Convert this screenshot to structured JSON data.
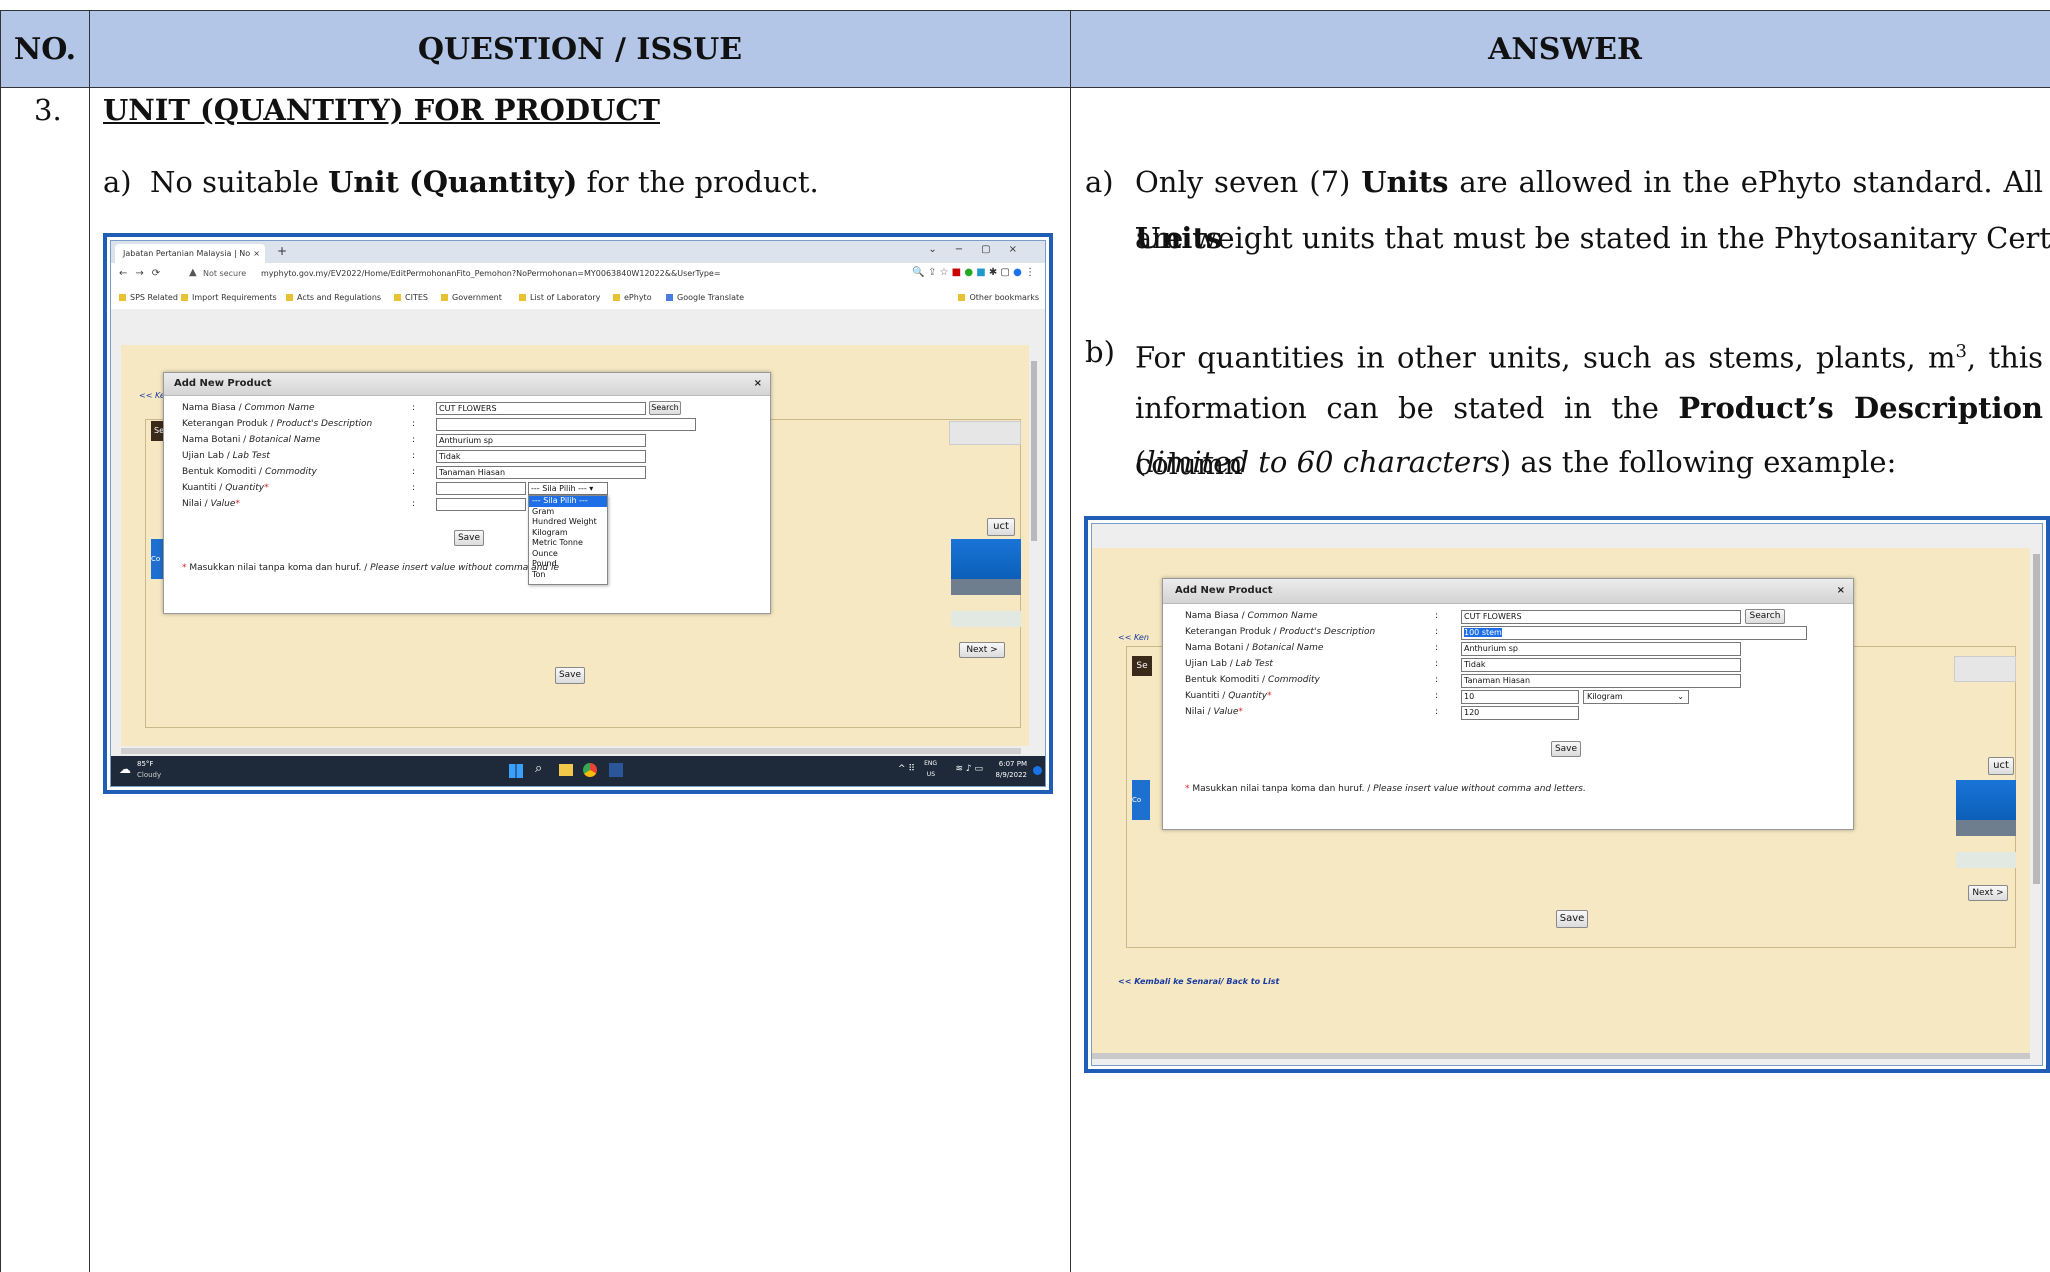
{
  "header": {
    "no": "NO.",
    "question": "QUESTION / ISSUE",
    "answer": "ANSWER"
  },
  "row": {
    "number": "3.",
    "title": "UNIT (QUANTITY) FOR PRODUCT"
  },
  "question": {
    "prefix": "a)",
    "text_before": "No suitable ",
    "bold": "Unit (Quantity)",
    "text_after": " for the product."
  },
  "answer": {
    "a_prefix": "a)",
    "a_line1_pre": "Only seven (7) ",
    "a_line1_bold1": "Units",
    "a_line1_mid": " are allowed in the ePhyto standard. All ",
    "a_line1_bold2": "Units",
    "a_line2": "are weight units that must be stated in the Phytosanitary Certificate.",
    "b_prefix": "b)",
    "b_line1_pre": "For quantities in other units, such as stems, plants, m",
    "b_line1_sup": "3",
    "b_line1_post": ", this",
    "b_line2_pre": "information can be stated in the ",
    "b_line2_bold": "Product’s Description",
    "b_line2_post": " column",
    "b_line3_open": "(",
    "b_line3_italic": "limited to 60 characters",
    "b_line3_post": ") as the following example:"
  },
  "shot1": {
    "tab_title": "Jabatan Pertanian Malaysia | No",
    "not_secure": "Not secure",
    "url": "myphyto.gov.my/EV2022/Home/EditPermohonanFito_Pemohon?NoPermohonan=MY0063840W12022&&UserType=",
    "bookmarks": [
      "SPS Related",
      "Import Requirements",
      "Acts and Regulations",
      "CITES",
      "Government",
      "List of Laboratory",
      "ePhyto",
      "Google Translate"
    ],
    "other_bookmarks": "Other bookmarks",
    "back_link": "<< Ken",
    "dialog_title": "Add New Product",
    "close": "×",
    "fields": [
      {
        "label": "Nama Biasa / ",
        "label_it": "Common Name",
        "value": "CUT FLOWERS"
      },
      {
        "label": "Keterangan Produk / ",
        "label_it": "Product's Description",
        "value": ""
      },
      {
        "label": "Nama Botani / ",
        "label_it": "Botanical Name",
        "value": "Anthurium sp"
      },
      {
        "label": "Ujian Lab / ",
        "label_it": "Lab Test",
        "value": "Tidak"
      },
      {
        "label": "Bentuk Komoditi / ",
        "label_it": "Commodity",
        "value": "Tanaman Hiasan"
      },
      {
        "label": "Kuantiti / ",
        "label_it": "Quantity",
        "value": ""
      },
      {
        "label": "Nilai / ",
        "label_it": "Value",
        "value": ""
      }
    ],
    "colon": ":",
    "search": "Search",
    "select_value": "--- Sila Pilih --- ▾",
    "options": [
      "--- Sila Pilih ---",
      "Gram",
      "Hundred Weight",
      "Kilogram",
      "Metric Tonne",
      "Ounce",
      "Pound",
      "Ton"
    ],
    "save": "Save",
    "note": "Masukkan nilai tanpa koma dan huruf. / ",
    "note_it": "Please insert value without comma and le",
    "side_uct": "uct",
    "next": "Next >",
    "se": "Se",
    "co": "Co",
    "weather_temp": "85°F",
    "weather_desc": "Cloudy",
    "lang": "ENG",
    "lang2": "US",
    "time": "6:07 PM",
    "date": "8/9/2022"
  },
  "shot2": {
    "back_link": "<< Ken",
    "dialog_title": "Add New Product",
    "close": "×",
    "fields": [
      {
        "label": "Nama Biasa / ",
        "label_it": "Common Name",
        "value": "CUT FLOWERS"
      },
      {
        "label": "Keterangan Produk / ",
        "label_it": "Product's Description",
        "value": "100 stem"
      },
      {
        "label": "Nama Botani / ",
        "label_it": "Botanical Name",
        "value": "Anthurium sp"
      },
      {
        "label": "Ujian Lab / ",
        "label_it": "Lab Test",
        "value": "Tidak"
      },
      {
        "label": "Bentuk Komoditi / ",
        "label_it": "Commodity",
        "value": "Tanaman Hiasan"
      },
      {
        "label": "Kuantiti / ",
        "label_it": "Quantity",
        "value": "10"
      },
      {
        "label": "Nilai / ",
        "label_it": "Value",
        "value": "120"
      }
    ],
    "colon": ":",
    "search": "Search",
    "unit_value": "Kilogram",
    "save": "Save",
    "note": "Masukkan nilai tanpa koma dan huruf. / ",
    "note_it": "Please insert value without comma and letters.",
    "side_uct": "uct",
    "next": "Next >",
    "se": "Se",
    "co": "Co",
    "back_to_list": "<< Kembali ke Senarai/ Back to List"
  },
  "colors": {
    "header_bg": "#b3c6e8",
    "shot_border": "#1f5db6",
    "cream": "#f5e8c2"
  }
}
